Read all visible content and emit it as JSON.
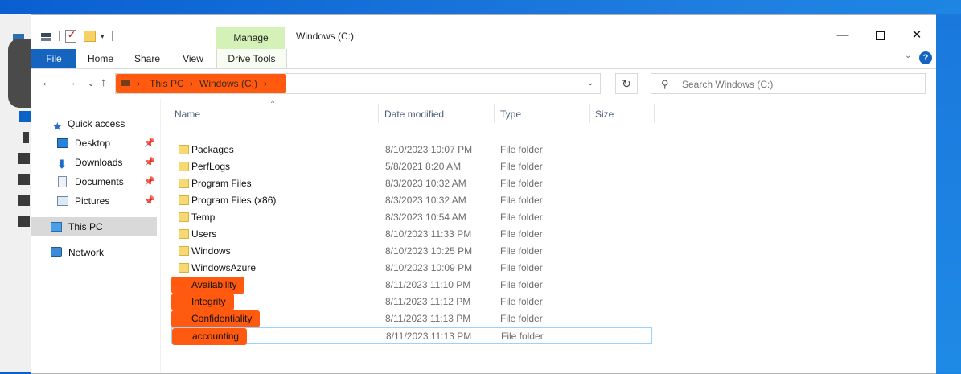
{
  "window": {
    "title": "Windows (C:)"
  },
  "titlebar": {
    "manage_label": "Manage",
    "minimize_icon": "—",
    "close_icon": "✕",
    "qat_dropdown_icon": "▾"
  },
  "ribbon": {
    "tabs": [
      {
        "label": "File"
      },
      {
        "label": "Home"
      },
      {
        "label": "Share"
      },
      {
        "label": "View"
      },
      {
        "label": "Drive Tools"
      }
    ],
    "collapse_icon": "⌄",
    "help_icon": "?"
  },
  "navbar": {
    "back_icon": "←",
    "forward_icon": "→",
    "recent_icon": "⌄",
    "up_icon": "↑",
    "breadcrumb": [
      {
        "label": "This PC"
      },
      {
        "label": "Windows (C:)"
      }
    ],
    "breadcrumb_sep": "›",
    "dropdown_icon": "⌄",
    "refresh_icon": "↻",
    "search_placeholder": "Search Windows (C:)",
    "search_icon": "⚲"
  },
  "sidebar": {
    "pin_icon": "📌",
    "items": [
      {
        "label": "Quick access",
        "icon": "star-icon"
      },
      {
        "label": "Desktop",
        "icon": "desktop-icon"
      },
      {
        "label": "Downloads",
        "icon": "download-icon"
      },
      {
        "label": "Documents",
        "icon": "documents-icon"
      },
      {
        "label": "Pictures",
        "icon": "pictures-icon"
      },
      {
        "label": "This PC",
        "icon": "computer-icon"
      },
      {
        "label": "Network",
        "icon": "network-icon"
      }
    ]
  },
  "filelist": {
    "sort_indicator": "^",
    "columns": [
      {
        "label": "Name"
      },
      {
        "label": "Date modified"
      },
      {
        "label": "Type"
      },
      {
        "label": "Size"
      }
    ],
    "rows": [
      {
        "name": "Packages",
        "date": "8/10/2023 10:07 PM",
        "type": "File folder"
      },
      {
        "name": "PerfLogs",
        "date": "5/8/2021 8:20 AM",
        "type": "File folder"
      },
      {
        "name": "Program Files",
        "date": "8/3/2023 10:32 AM",
        "type": "File folder"
      },
      {
        "name": "Program Files (x86)",
        "date": "8/3/2023 10:32 AM",
        "type": "File folder"
      },
      {
        "name": "Temp",
        "date": "8/3/2023 10:54 AM",
        "type": "File folder"
      },
      {
        "name": "Users",
        "date": "8/10/2023 11:33 PM",
        "type": "File folder"
      },
      {
        "name": "Windows",
        "date": "8/10/2023 10:25 PM",
        "type": "File folder"
      },
      {
        "name": "WindowsAzure",
        "date": "8/10/2023 10:09 PM",
        "type": "File folder"
      },
      {
        "name": "Availability",
        "date": "8/11/2023 11:10 PM",
        "type": "File folder"
      },
      {
        "name": "Integrity",
        "date": "8/11/2023 11:12 PM",
        "type": "File folder"
      },
      {
        "name": "Confidentiality",
        "date": "8/11/2023 11:13 PM",
        "type": "File folder"
      },
      {
        "name": "accounting",
        "date": "8/11/2023 11:13 PM",
        "type": "File folder"
      }
    ]
  },
  "colors": {
    "accent": "#1565c0",
    "manage_tab": "#d4f1b8",
    "redaction": "#ff5a0f",
    "folder": "#f7d872",
    "selection_border": "#99d1ff"
  }
}
